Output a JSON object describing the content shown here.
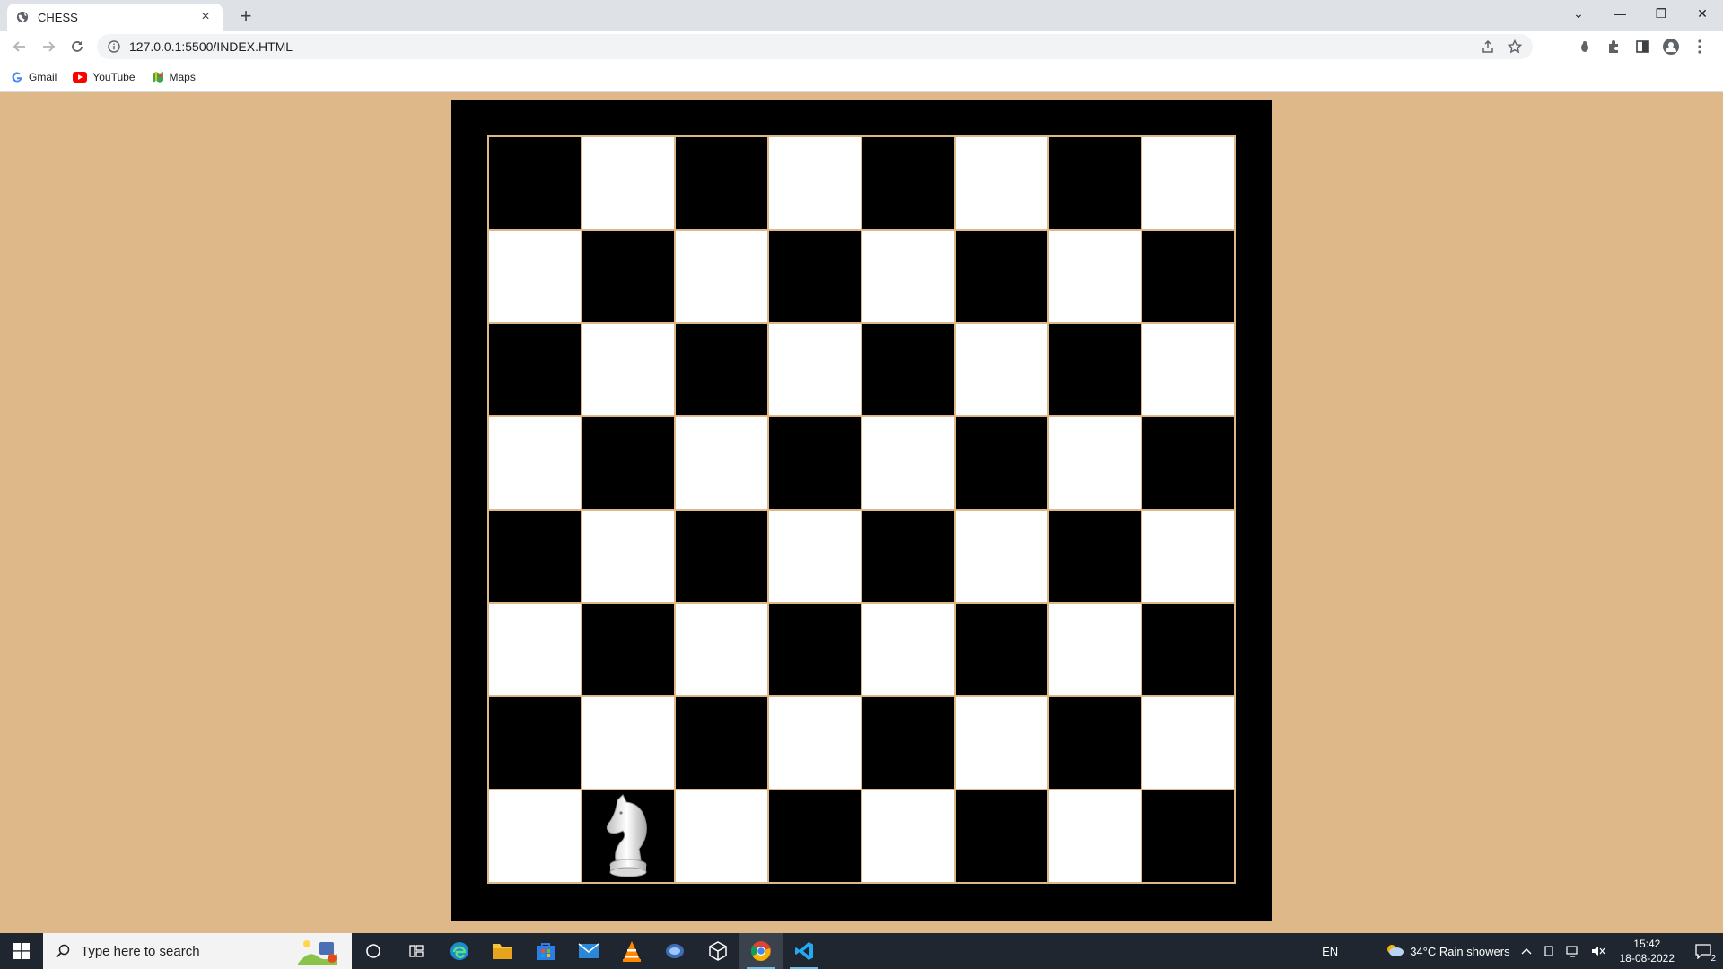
{
  "browser": {
    "tab": {
      "title": "CHESS",
      "close": "×"
    },
    "new_tab": "+",
    "window_controls": {
      "dropdown": "⌄",
      "minimize": "—",
      "restore": "❐",
      "close": "✕"
    },
    "address": {
      "url": "127.0.0.1:5500/INDEX.HTML"
    },
    "bookmarks": [
      {
        "label": "Gmail",
        "icon": "google-icon"
      },
      {
        "label": "YouTube",
        "icon": "youtube-icon"
      },
      {
        "label": "Maps",
        "icon": "maps-icon"
      }
    ]
  },
  "board": {
    "rows": 8,
    "cols": 8,
    "top_left_color": "dark",
    "colors": {
      "dark": "#000000",
      "light": "#ffffff",
      "frame": "#000000",
      "background": "#dfb889"
    },
    "pieces": [
      {
        "piece": "knight",
        "color": "white",
        "row": 8,
        "col": 2
      }
    ]
  },
  "taskbar": {
    "search_placeholder": "Type here to search",
    "apps": [
      "cortana-icon",
      "task-view-icon",
      "edge-icon",
      "file-explorer-icon",
      "store-icon",
      "mail-icon",
      "vlc-icon",
      "app-icon",
      "virtualbox-icon",
      "chrome-icon",
      "vscode-icon"
    ],
    "tray": {
      "language": "EN",
      "weather": "34°C  Rain showers",
      "time": "15:42",
      "date": "18-08-2022",
      "notifications": "2"
    }
  }
}
